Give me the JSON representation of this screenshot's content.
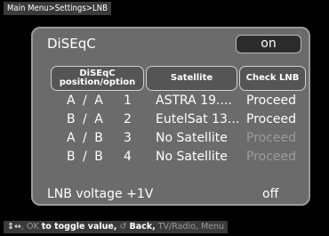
{
  "breadcrumb": "Main Menu>Settings>LNB",
  "dialog": {
    "title": "DiSEqC",
    "toggle_value": "on",
    "columns": [
      "DiSEqC position/option",
      "Satellite",
      "Check LNB"
    ],
    "rows": [
      {
        "position": "A / A",
        "number": "1",
        "satellite": "ASTRA 19....",
        "action": "Proceed",
        "enabled": true
      },
      {
        "position": "B / A",
        "number": "2",
        "satellite": "EutelSat 13...",
        "action": "Proceed",
        "enabled": true
      },
      {
        "position": "A / B",
        "number": "3",
        "satellite": "No Satellite",
        "action": "Proceed",
        "enabled": false
      },
      {
        "position": "B / B",
        "number": "4",
        "satellite": "No Satellite",
        "action": "Proceed",
        "enabled": false
      }
    ],
    "lnb_voltage_label": "LNB voltage +1V",
    "lnb_voltage_value": "off"
  },
  "statusbar": {
    "nav_hint": ", OK",
    "toggle_hint": "to toggle value,",
    "back_hint": "Back,",
    "extra_hint": "TV/Radio, Menu"
  }
}
